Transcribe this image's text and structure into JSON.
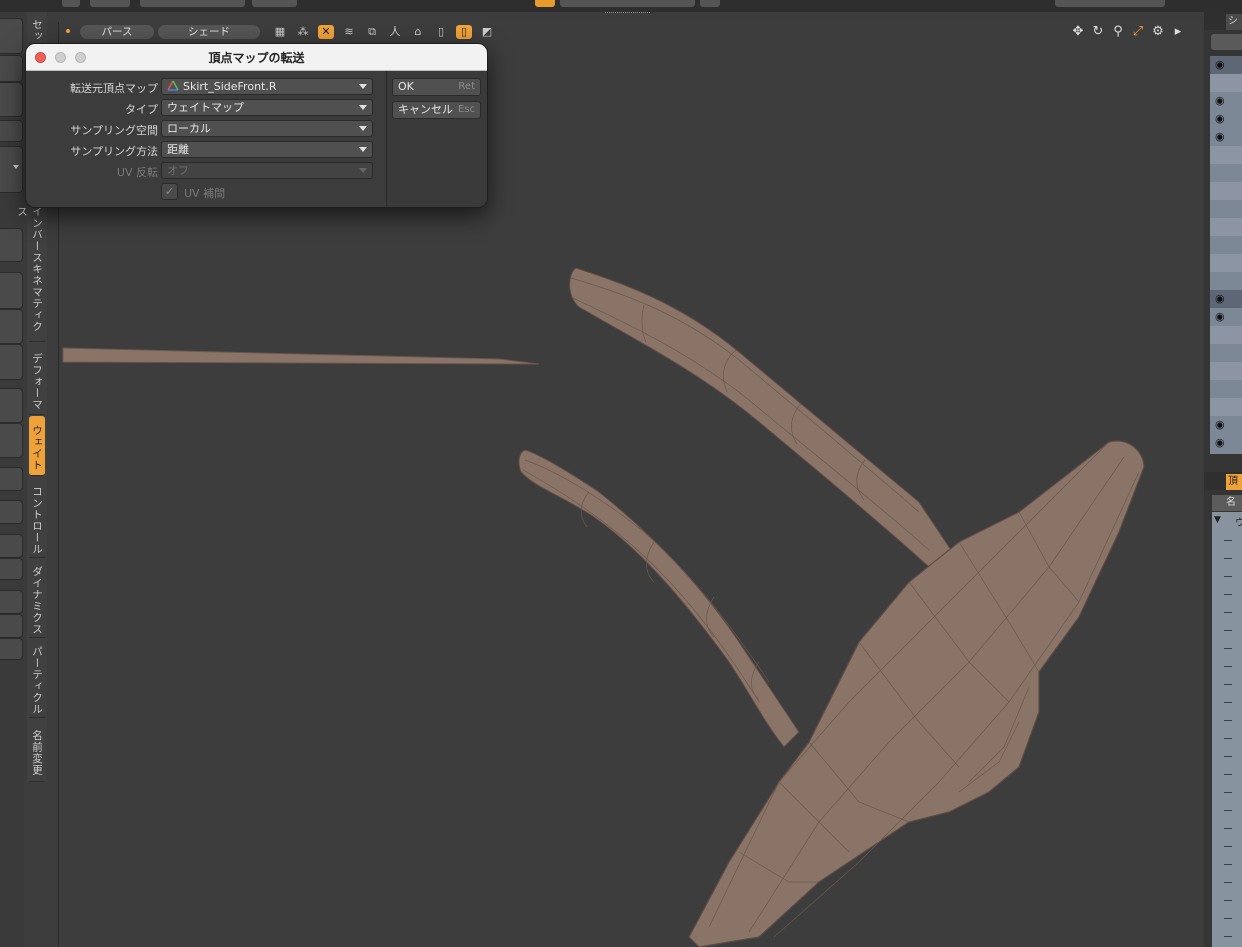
{
  "dialog": {
    "title": "頂点マップの転送",
    "fields": [
      {
        "label": "転送元頂点マップ",
        "value": "Skirt_SideFront.R"
      },
      {
        "label": "タイプ",
        "value": "ウェイトマップ"
      },
      {
        "label": "サンプリング空間",
        "value": "ローカル"
      },
      {
        "label": "サンプリング方法",
        "value": "距離"
      },
      {
        "label": "UV 反転",
        "value": "オフ"
      }
    ],
    "checkbox": {
      "label": "UV 補間",
      "checked": true
    },
    "buttons": {
      "ok": {
        "label": "OK",
        "key": "Ret"
      },
      "cancel": {
        "label": "キャンセル",
        "key": "Esc"
      }
    }
  },
  "viewport": {
    "view_label": "パース",
    "shade_label": "シェード"
  },
  "side_tabs": [
    "セッ",
    "インバースキネマティクス",
    "デフォーマ",
    "ウェイト",
    "コントロール",
    "ダイナミクス",
    "パーティクル",
    "名前変更"
  ],
  "right_panel": {
    "tab_top": "シ",
    "tab_mid": "頂",
    "column_header": "名前",
    "tree_item": "ウ"
  },
  "colors": {
    "accent": "#f0a23a",
    "mesh_fill": "#8a7467",
    "mesh_edge": "#5d4c43",
    "background": "#3d3d3d"
  }
}
